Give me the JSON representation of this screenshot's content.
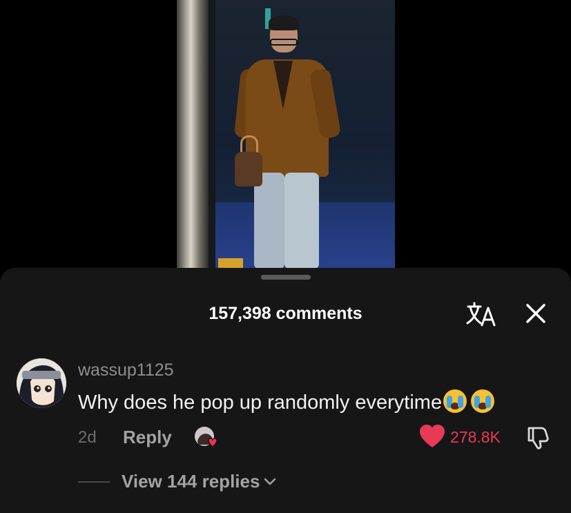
{
  "video": {
    "scene": "person-walking-video-frame"
  },
  "sheet": {
    "title": "157,398 comments",
    "icons": {
      "translate": "translate-icon",
      "close": "close-icon"
    }
  },
  "comment": {
    "username": "wassup1125",
    "text": "Why does he pop up randomly everytime",
    "emoji_count": 2,
    "time": "2d",
    "reply_label": "Reply",
    "likes": "278.8K",
    "liked": true,
    "view_replies": "View 144 replies"
  },
  "colors": {
    "background": "#000000",
    "sheet": "#161616",
    "like": "#e83a57",
    "muted_text": "#8e8e8e"
  }
}
